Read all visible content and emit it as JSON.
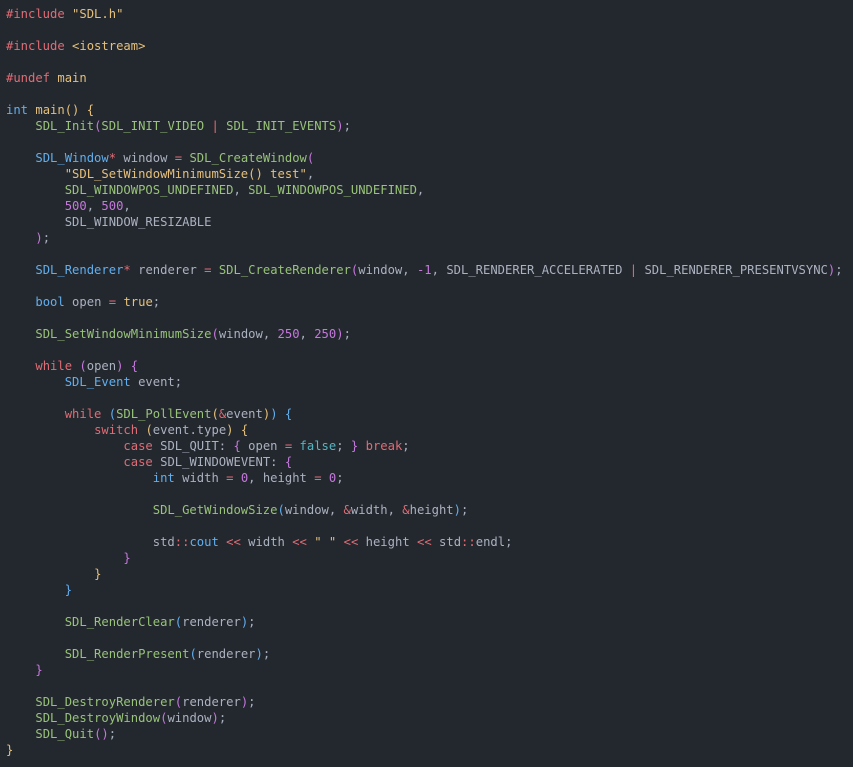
{
  "colors": {
    "background": "#23272e",
    "plain": "#abb2bf",
    "preprocessor": "#e06c75",
    "string": "#e5c07b",
    "keyword": "#c678dd",
    "control": "#e06c75",
    "function": "#98c379",
    "type": "#61afef",
    "number": "#d19a66",
    "operator": "#e06c75",
    "constant": "#56b6c2",
    "paren1": "#e5c07b",
    "paren2": "#c678dd",
    "paren3": "#61afef"
  },
  "lines": [
    [
      [
        "#include ",
        "preprocessor"
      ],
      [
        "\"SDL.h\"",
        "string"
      ]
    ],
    [],
    [
      [
        "#include ",
        "preprocessor"
      ],
      [
        "<iostream>",
        "string"
      ]
    ],
    [],
    [
      [
        "#undef ",
        "preprocessor"
      ],
      [
        "main",
        "string"
      ]
    ],
    [],
    [
      [
        "int ",
        "type"
      ],
      [
        "main",
        "string"
      ],
      [
        "()",
        "paren1"
      ],
      [
        " ",
        "plain"
      ],
      [
        "{",
        "paren1"
      ]
    ],
    [
      [
        "    ",
        "plain"
      ],
      [
        "SDL_Init",
        "function"
      ],
      [
        "(",
        "paren2"
      ],
      [
        "SDL_INIT_VIDEO",
        "function"
      ],
      [
        " | ",
        "operator"
      ],
      [
        "SDL_INIT_EVENTS",
        "function"
      ],
      [
        ")",
        "paren2"
      ],
      [
        ";",
        "plain"
      ]
    ],
    [],
    [
      [
        "    ",
        "plain"
      ],
      [
        "SDL_Window",
        "type"
      ],
      [
        "*",
        "operator"
      ],
      [
        " window ",
        "plain"
      ],
      [
        "=",
        "operator"
      ],
      [
        " ",
        "plain"
      ],
      [
        "SDL_CreateWindow",
        "function"
      ],
      [
        "(",
        "paren2"
      ]
    ],
    [
      [
        "        ",
        "plain"
      ],
      [
        "\"SDL_SetWindowMinimumSize() test\"",
        "string"
      ],
      [
        ",",
        "plain"
      ]
    ],
    [
      [
        "        ",
        "plain"
      ],
      [
        "SDL_WINDOWPOS_UNDEFINED",
        "function"
      ],
      [
        ", ",
        "plain"
      ],
      [
        "SDL_WINDOWPOS_UNDEFINED",
        "function"
      ],
      [
        ",",
        "plain"
      ]
    ],
    [
      [
        "        ",
        "plain"
      ],
      [
        "500",
        "keyword"
      ],
      [
        ", ",
        "plain"
      ],
      [
        "500",
        "keyword"
      ],
      [
        ",",
        "plain"
      ]
    ],
    [
      [
        "        ",
        "plain"
      ],
      [
        "SDL_WINDOW_RESIZABLE",
        "plain"
      ]
    ],
    [
      [
        "    ",
        "plain"
      ],
      [
        ")",
        "paren2"
      ],
      [
        ";",
        "plain"
      ]
    ],
    [],
    [
      [
        "    ",
        "plain"
      ],
      [
        "SDL_Renderer",
        "type"
      ],
      [
        "*",
        "operator"
      ],
      [
        " renderer ",
        "plain"
      ],
      [
        "=",
        "operator"
      ],
      [
        " ",
        "plain"
      ],
      [
        "SDL_CreateRenderer",
        "function"
      ],
      [
        "(",
        "paren2"
      ],
      [
        "window, ",
        "plain"
      ],
      [
        "-1",
        "keyword"
      ],
      [
        ", SDL_RENDERER_ACCELERATED ",
        "plain"
      ],
      [
        "|",
        "operator"
      ],
      [
        " SDL_RENDERER_PRESENTVSYNC",
        "plain"
      ],
      [
        ")",
        "paren2"
      ],
      [
        ";",
        "plain"
      ]
    ],
    [],
    [
      [
        "    ",
        "plain"
      ],
      [
        "bool",
        "type"
      ],
      [
        " open ",
        "plain"
      ],
      [
        "=",
        "operator"
      ],
      [
        " ",
        "plain"
      ],
      [
        "true",
        "string"
      ],
      [
        ";",
        "plain"
      ]
    ],
    [],
    [
      [
        "    ",
        "plain"
      ],
      [
        "SDL_SetWindowMinimumSize",
        "function"
      ],
      [
        "(",
        "paren2"
      ],
      [
        "window, ",
        "plain"
      ],
      [
        "250",
        "keyword"
      ],
      [
        ", ",
        "plain"
      ],
      [
        "250",
        "keyword"
      ],
      [
        ")",
        "paren2"
      ],
      [
        ";",
        "plain"
      ]
    ],
    [],
    [
      [
        "    ",
        "plain"
      ],
      [
        "while",
        "control"
      ],
      [
        " ",
        "plain"
      ],
      [
        "(",
        "paren2"
      ],
      [
        "open",
        "plain"
      ],
      [
        ")",
        "paren2"
      ],
      [
        " ",
        "plain"
      ],
      [
        "{",
        "paren2"
      ]
    ],
    [
      [
        "        ",
        "plain"
      ],
      [
        "SDL_Event",
        "type"
      ],
      [
        " event;",
        "plain"
      ]
    ],
    [],
    [
      [
        "        ",
        "plain"
      ],
      [
        "while",
        "control"
      ],
      [
        " ",
        "plain"
      ],
      [
        "(",
        "paren3"
      ],
      [
        "SDL_PollEvent",
        "function"
      ],
      [
        "(",
        "paren1"
      ],
      [
        "&",
        "operator"
      ],
      [
        "event",
        "plain"
      ],
      [
        ")",
        "paren1"
      ],
      [
        ")",
        "paren3"
      ],
      [
        " ",
        "plain"
      ],
      [
        "{",
        "paren3"
      ]
    ],
    [
      [
        "            ",
        "plain"
      ],
      [
        "switch",
        "control"
      ],
      [
        " ",
        "plain"
      ],
      [
        "(",
        "paren1"
      ],
      [
        "event.type",
        "plain"
      ],
      [
        ")",
        "paren1"
      ],
      [
        " ",
        "plain"
      ],
      [
        "{",
        "paren1"
      ]
    ],
    [
      [
        "                ",
        "plain"
      ],
      [
        "case",
        "control"
      ],
      [
        " SDL_QUIT: ",
        "plain"
      ],
      [
        "{",
        "paren2"
      ],
      [
        " open ",
        "plain"
      ],
      [
        "=",
        "operator"
      ],
      [
        " ",
        "plain"
      ],
      [
        "false",
        "constant"
      ],
      [
        "; ",
        "plain"
      ],
      [
        "}",
        "paren2"
      ],
      [
        " ",
        "plain"
      ],
      [
        "break",
        "control"
      ],
      [
        ";",
        "plain"
      ]
    ],
    [
      [
        "                ",
        "plain"
      ],
      [
        "case",
        "control"
      ],
      [
        " SDL_WINDOWEVENT: ",
        "plain"
      ],
      [
        "{",
        "paren2"
      ]
    ],
    [
      [
        "                    ",
        "plain"
      ],
      [
        "int",
        "type"
      ],
      [
        " width ",
        "plain"
      ],
      [
        "=",
        "operator"
      ],
      [
        " ",
        "plain"
      ],
      [
        "0",
        "keyword"
      ],
      [
        ", height ",
        "plain"
      ],
      [
        "=",
        "operator"
      ],
      [
        " ",
        "plain"
      ],
      [
        "0",
        "keyword"
      ],
      [
        ";",
        "plain"
      ]
    ],
    [],
    [
      [
        "                    ",
        "plain"
      ],
      [
        "SDL_GetWindowSize",
        "function"
      ],
      [
        "(",
        "paren3"
      ],
      [
        "window, ",
        "plain"
      ],
      [
        "&",
        "operator"
      ],
      [
        "width, ",
        "plain"
      ],
      [
        "&",
        "operator"
      ],
      [
        "height",
        "plain"
      ],
      [
        ")",
        "paren3"
      ],
      [
        ";",
        "plain"
      ]
    ],
    [],
    [
      [
        "                    ",
        "plain"
      ],
      [
        "std",
        "plain"
      ],
      [
        "::",
        "operator"
      ],
      [
        "cout",
        "type"
      ],
      [
        " ",
        "plain"
      ],
      [
        "<<",
        "operator"
      ],
      [
        " width ",
        "plain"
      ],
      [
        "<<",
        "operator"
      ],
      [
        " ",
        "plain"
      ],
      [
        "\" \"",
        "string"
      ],
      [
        " ",
        "plain"
      ],
      [
        "<<",
        "operator"
      ],
      [
        " height ",
        "plain"
      ],
      [
        "<<",
        "operator"
      ],
      [
        " std",
        "plain"
      ],
      [
        "::",
        "operator"
      ],
      [
        "endl",
        "plain"
      ],
      [
        ";",
        "plain"
      ]
    ],
    [
      [
        "                ",
        "plain"
      ],
      [
        "}",
        "paren2"
      ]
    ],
    [
      [
        "            ",
        "plain"
      ],
      [
        "}",
        "paren1"
      ]
    ],
    [
      [
        "        ",
        "plain"
      ],
      [
        "}",
        "paren3"
      ]
    ],
    [],
    [
      [
        "        ",
        "plain"
      ],
      [
        "SDL_RenderClear",
        "function"
      ],
      [
        "(",
        "paren3"
      ],
      [
        "renderer",
        "plain"
      ],
      [
        ")",
        "paren3"
      ],
      [
        ";",
        "plain"
      ]
    ],
    [],
    [
      [
        "        ",
        "plain"
      ],
      [
        "SDL_RenderPresent",
        "function"
      ],
      [
        "(",
        "paren3"
      ],
      [
        "renderer",
        "plain"
      ],
      [
        ")",
        "paren3"
      ],
      [
        ";",
        "plain"
      ]
    ],
    [
      [
        "    ",
        "plain"
      ],
      [
        "}",
        "paren2"
      ]
    ],
    [],
    [
      [
        "    ",
        "plain"
      ],
      [
        "SDL_DestroyRenderer",
        "function"
      ],
      [
        "(",
        "paren2"
      ],
      [
        "renderer",
        "plain"
      ],
      [
        ")",
        "paren2"
      ],
      [
        ";",
        "plain"
      ]
    ],
    [
      [
        "    ",
        "plain"
      ],
      [
        "SDL_DestroyWindow",
        "function"
      ],
      [
        "(",
        "paren2"
      ],
      [
        "window",
        "plain"
      ],
      [
        ")",
        "paren2"
      ],
      [
        ";",
        "plain"
      ]
    ],
    [
      [
        "    ",
        "plain"
      ],
      [
        "SDL_Quit",
        "function"
      ],
      [
        "()",
        "paren2"
      ],
      [
        ";",
        "plain"
      ]
    ],
    [
      [
        "}",
        "paren1"
      ]
    ]
  ]
}
